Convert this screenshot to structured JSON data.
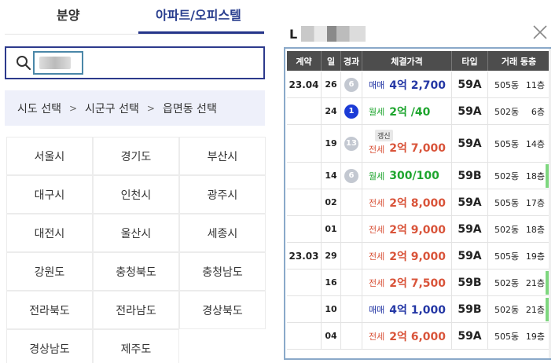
{
  "tabs": [
    {
      "label": "분양"
    },
    {
      "label": "아파트/오피스텔"
    }
  ],
  "search": {
    "value": "",
    "placeholder": ""
  },
  "region_bar": {
    "step1": "시도 선택",
    "step2": "시군구 선택",
    "step3": "읍면동 선택",
    "separator": ">"
  },
  "regions": [
    "서울시",
    "경기도",
    "부산시",
    "대구시",
    "인천시",
    "광주시",
    "대전시",
    "울산시",
    "세종시",
    "강원도",
    "충청북도",
    "충청남도",
    "전라북도",
    "전라남도",
    "경상북도",
    "경상남도",
    "제주도"
  ],
  "panel": {
    "title_prefix": "L"
  },
  "table": {
    "headers": {
      "month": "계약",
      "day": "일",
      "badge": "경과",
      "price": "체결가격",
      "type": "타입",
      "unit": "거래 동층"
    },
    "rows": [
      {
        "month": "23.04",
        "day": "26",
        "badge": "6",
        "badge_color": "gray",
        "kind": "매매",
        "amount": "4억 2,700",
        "kind_class": "sale",
        "renew": "",
        "type": "59A",
        "dong": "505동",
        "floor": "11층",
        "mark": false
      },
      {
        "month": "",
        "day": "24",
        "badge": "1",
        "badge_color": "blue",
        "kind": "월세",
        "amount": "2억 /40",
        "kind_class": "monthly",
        "renew": "",
        "type": "59A",
        "dong": "502동",
        "floor": "6층",
        "mark": false
      },
      {
        "month": "",
        "day": "19",
        "badge": "13",
        "badge_color": "gray",
        "kind": "전세",
        "amount": "2억 7,000",
        "kind_class": "jeonse",
        "renew": "갱신",
        "type": "59A",
        "dong": "505동",
        "floor": "14층",
        "mark": false
      },
      {
        "month": "",
        "day": "14",
        "badge": "6",
        "badge_color": "gray",
        "kind": "월세",
        "amount": "300/100",
        "kind_class": "monthly",
        "renew": "",
        "type": "59B",
        "dong": "502동",
        "floor": "18층",
        "mark": true
      },
      {
        "month": "",
        "day": "02",
        "badge": "",
        "badge_color": "",
        "kind": "전세",
        "amount": "2억 8,000",
        "kind_class": "jeonse",
        "renew": "",
        "type": "59A",
        "dong": "505동",
        "floor": "17층",
        "mark": false
      },
      {
        "month": "",
        "day": "01",
        "badge": "",
        "badge_color": "",
        "kind": "전세",
        "amount": "2억 9,000",
        "kind_class": "jeonse",
        "renew": "",
        "type": "59A",
        "dong": "502동",
        "floor": "18층",
        "mark": false
      },
      {
        "month": "23.03",
        "day": "29",
        "badge": "",
        "badge_color": "",
        "kind": "전세",
        "amount": "2억 9,000",
        "kind_class": "jeonse",
        "renew": "",
        "type": "59A",
        "dong": "505동",
        "floor": "19층",
        "mark": false
      },
      {
        "month": "",
        "day": "16",
        "badge": "",
        "badge_color": "",
        "kind": "전세",
        "amount": "2억 7,500",
        "kind_class": "jeonse",
        "renew": "",
        "type": "59B",
        "dong": "502동",
        "floor": "21층",
        "mark": true
      },
      {
        "month": "",
        "day": "10",
        "badge": "",
        "badge_color": "",
        "kind": "매매",
        "amount": "4억 1,000",
        "kind_class": "sale",
        "renew": "",
        "type": "59B",
        "dong": "502동",
        "floor": "21층",
        "mark": true
      },
      {
        "month": "",
        "day": "04",
        "badge": "",
        "badge_color": "",
        "kind": "전세",
        "amount": "2억 6,000",
        "kind_class": "jeonse",
        "renew": "",
        "type": "59A",
        "dong": "505동",
        "floor": "19층",
        "mark": false
      }
    ]
  },
  "colors": {
    "accent": "#25358a",
    "sale": "#2437a5",
    "monthly": "#1ea52e",
    "jeonse": "#d9543a",
    "header_bg": "#4d4d4d"
  },
  "icons": {
    "search": "search-icon",
    "close": "close-icon"
  }
}
